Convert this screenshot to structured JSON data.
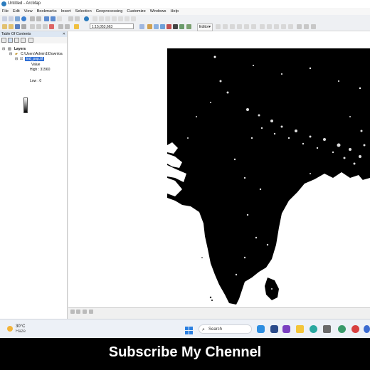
{
  "window": {
    "title": "Untitled - ArcMap"
  },
  "menu": [
    "File",
    "Edit",
    "View",
    "Bookmarks",
    "Insert",
    "Selection",
    "Geoprocessing",
    "Customize",
    "Windows",
    "Help"
  ],
  "toolbar": {
    "scale": "1:15,053,663",
    "editor_label": "Editor▾"
  },
  "toc": {
    "title": "Table Of Contents",
    "close": "✕",
    "layers_label": "Layers",
    "folder_path": "C:\\Users\\Admin1\\Downloa",
    "layer_name": "ind_pop.tif",
    "value_label": "Value",
    "high_label": "High : 31560",
    "low_label": "Low : 0"
  },
  "taskbar": {
    "weather_temp": "30°C",
    "weather_desc": "Haze",
    "search_placeholder": "Search"
  },
  "caption": "Subscribe My Chennel",
  "colors": {
    "accent": "#2f6fd6",
    "map_land": "#000000",
    "map_bg": "#ffffff"
  }
}
